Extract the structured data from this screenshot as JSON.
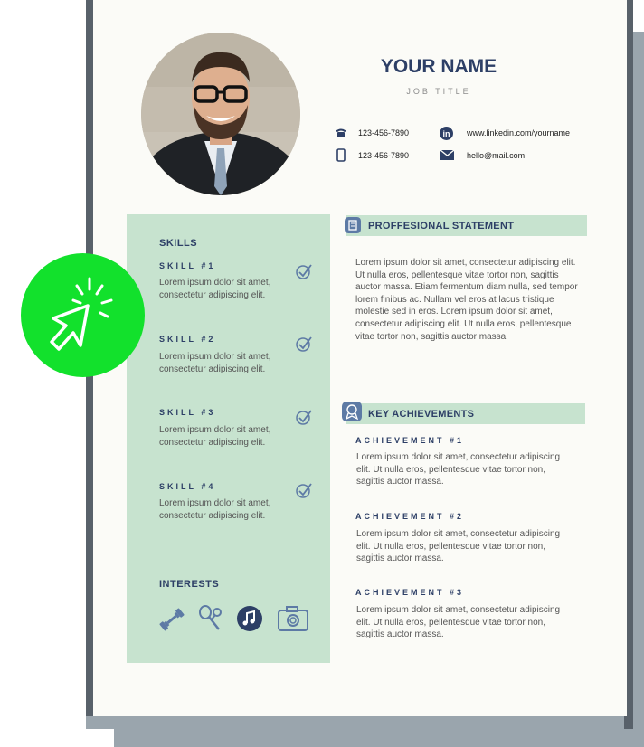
{
  "header": {
    "name": "YOUR NAME",
    "job_title": "JOB TITLE",
    "contacts": {
      "phone": "123-456-7890",
      "mobile": "123-456-7890",
      "linkedin": "www.linkedin.com/yourname",
      "email": "hello@mail.com"
    }
  },
  "skills": {
    "title": "SKILLS",
    "items": [
      {
        "name": "SKILL #1",
        "desc": "Lorem ipsum dolor sit amet, consectetur adipiscing elit."
      },
      {
        "name": "SKILL #2",
        "desc": "Lorem ipsum dolor sit amet, consectetur adipiscing elit."
      },
      {
        "name": "SKILL #3",
        "desc": "Lorem ipsum dolor sit amet, consectetur adipiscing elit."
      },
      {
        "name": "SKILL #4",
        "desc": "Lorem ipsum dolor sit amet, consectetur adipiscing elit."
      }
    ]
  },
  "interests": {
    "title": "INTERESTS",
    "icons": [
      "dumbbell-icon",
      "badminton-icon",
      "music-note-icon",
      "camera-icon"
    ]
  },
  "statement": {
    "title": "PROFFESIONAL STATEMENT",
    "text": "Lorem ipsum dolor sit amet, consectetur adipiscing elit. Ut nulla eros, pellentesque vitae tortor non, sagittis auctor massa. Etiam fermentum diam nulla, sed tempor lorem finibus ac. Nullam vel eros at lacus tristique molestie sed in eros. Lorem ipsum dolor sit amet, consectetur adipiscing elit. Ut nulla eros, pellentesque vitae tortor non, sagittis auctor massa."
  },
  "achievements": {
    "title": "KEY ACHIEVEMENTS",
    "items": [
      {
        "name": "ACHIEVEMENT #1",
        "desc": "Lorem ipsum dolor sit amet, consectetur adipiscing elit. Ut nulla eros, pellentesque vitae tortor non, sagittis auctor massa."
      },
      {
        "name": "ACHIEVEMENT #2",
        "desc": "Lorem ipsum dolor sit amet, consectetur adipiscing elit. Ut nulla eros, pellentesque vitae tortor non, sagittis auctor massa."
      },
      {
        "name": "ACHIEVEMENT #3",
        "desc": "Lorem ipsum dolor sit amet, consectetur adipiscing elit. Ut nulla eros, pellentesque vitae tortor non, sagittis auctor massa."
      }
    ]
  },
  "colors": {
    "accent_navy": "#2d3f66",
    "sidebar_green": "#c7e3cf",
    "badge_green": "#12e12c",
    "shadow_gray": "#9aa5ad"
  }
}
